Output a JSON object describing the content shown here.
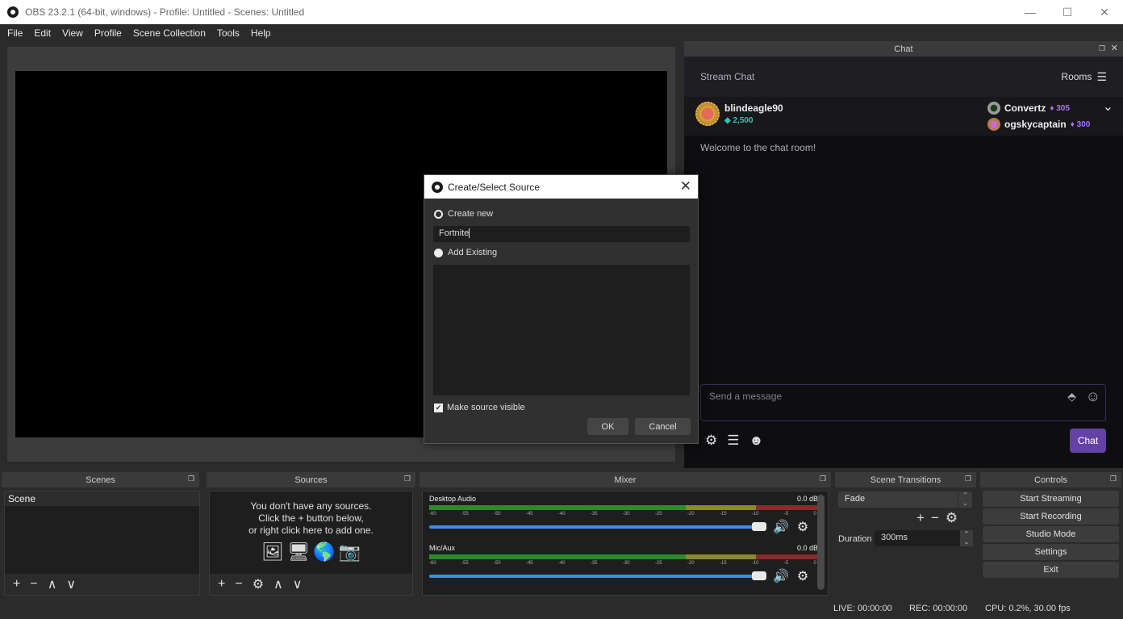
{
  "window": {
    "title": "OBS 23.2.1 (64-bit, windows) - Profile: Untitled - Scenes: Untitled",
    "controls": {
      "minimize": "—",
      "maximize": "☐",
      "close": "✕"
    }
  },
  "menu": [
    "File",
    "Edit",
    "View",
    "Profile",
    "Scene Collection",
    "Tools",
    "Help"
  ],
  "chat_dock": {
    "title": "Chat",
    "header_title": "Stream Chat",
    "rooms_label": "Rooms",
    "leaderboard": {
      "top": {
        "name": "blindeagle90",
        "bits": "2,500"
      },
      "others": [
        {
          "name": "Convertz",
          "points": "305"
        },
        {
          "name": "ogskycaptain",
          "points": "300"
        }
      ]
    },
    "welcome": "Welcome to the chat room!",
    "input_placeholder": "Send a message",
    "send_label": "Chat",
    "colors": {
      "accent": "#6441a5",
      "bits": "#2dc7b0",
      "points": "#a970ff"
    }
  },
  "dialog": {
    "title": "Create/Select Source",
    "create_new_label": "Create new",
    "name_value": "Fortnite",
    "add_existing_label": "Add Existing",
    "make_visible_label": "Make source visible",
    "make_visible_checked": true,
    "ok_label": "OK",
    "cancel_label": "Cancel"
  },
  "scenes": {
    "title": "Scenes",
    "items": [
      "Scene"
    ]
  },
  "sources": {
    "title": "Sources",
    "empty_lines": [
      "You don't have any sources.",
      "Click the + button below,",
      "or right click here to add one."
    ]
  },
  "mixer": {
    "title": "Mixer",
    "ticks": [
      "-60",
      "-55",
      "-50",
      "-45",
      "-40",
      "-35",
      "-30",
      "-25",
      "-20",
      "-15",
      "-10",
      "-5",
      "0"
    ],
    "tracks": [
      {
        "name": "Desktop Audio",
        "level": "0.0 dB",
        "volume_percent": 100
      },
      {
        "name": "Mic/Aux",
        "level": "0.0 dB",
        "volume_percent": 100
      }
    ]
  },
  "transitions": {
    "title": "Scene Transitions",
    "selected": "Fade",
    "duration_label": "Duration",
    "duration_value": "300ms"
  },
  "controls": {
    "title": "Controls",
    "buttons": [
      "Start Streaming",
      "Start Recording",
      "Studio Mode",
      "Settings",
      "Exit"
    ]
  },
  "status": {
    "live": "LIVE: 00:00:00",
    "rec": "REC: 00:00:00",
    "cpu": "CPU: 0.2%, 30.00 fps"
  }
}
